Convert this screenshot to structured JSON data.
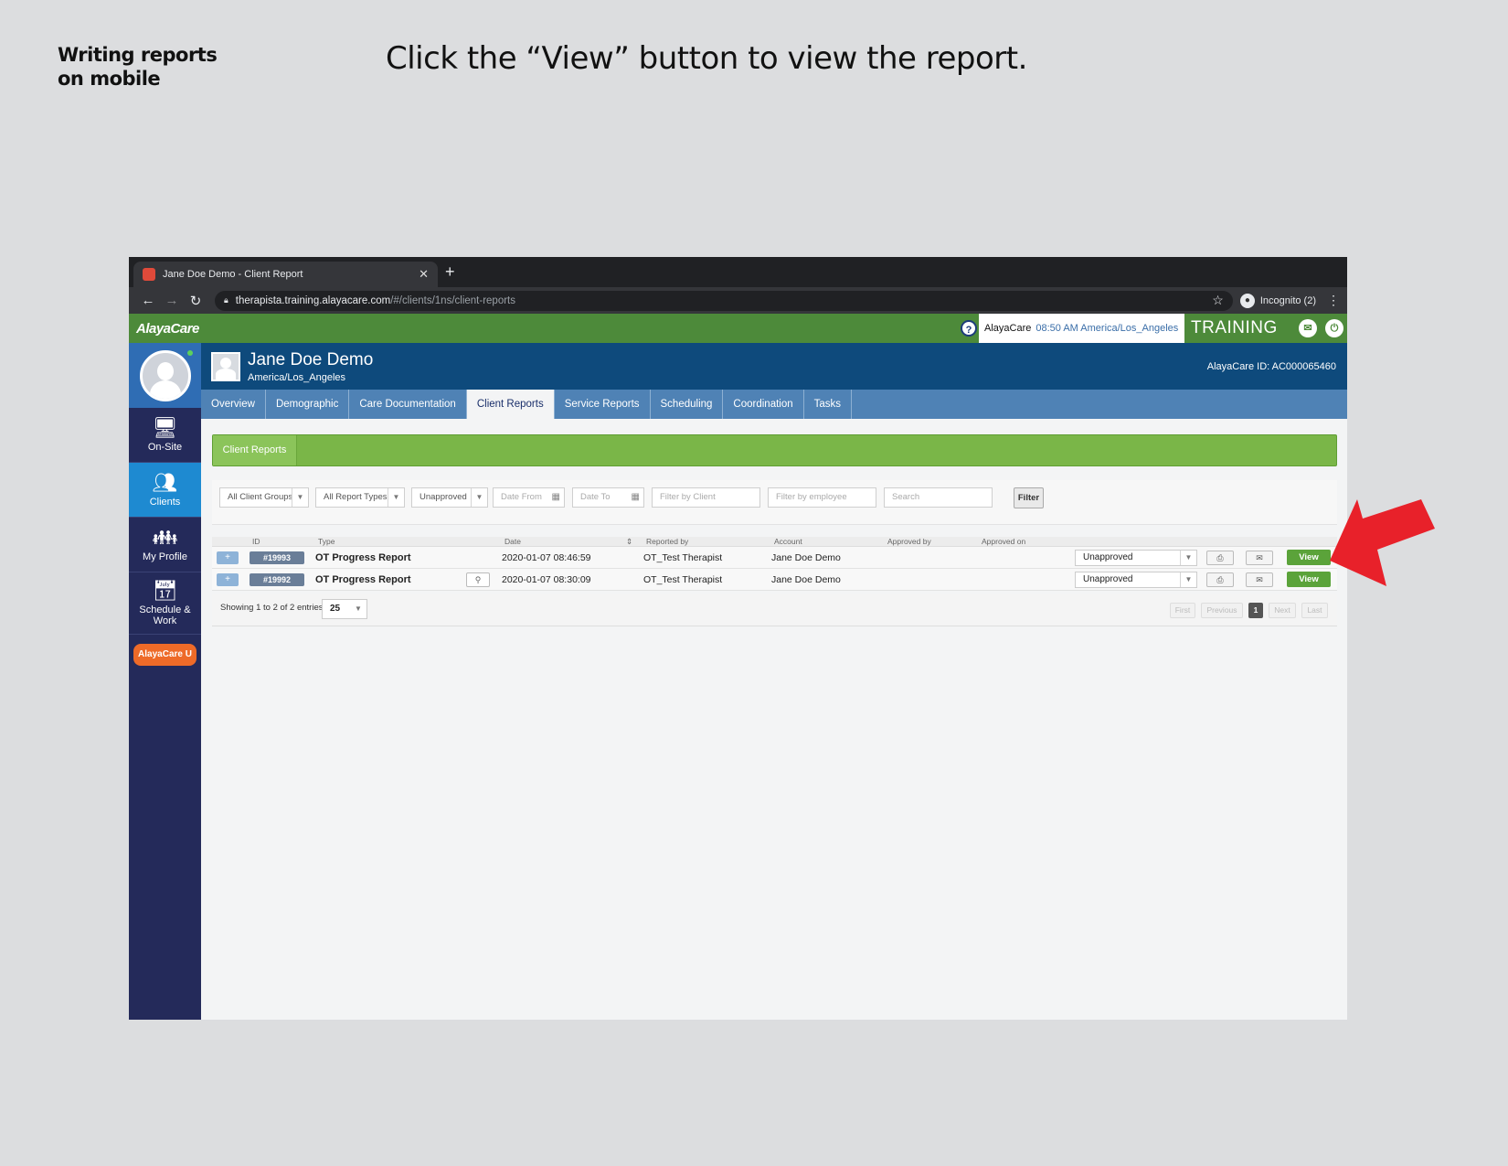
{
  "slide": {
    "section_line1": "Writing reports",
    "section_line2": "on mobile",
    "instruction": "Click the “View” button to view the report."
  },
  "browser": {
    "tab_title": "Jane Doe Demo - Client Report",
    "url_host": "therapista.training.alayacare.com",
    "url_path": "/#/clients/1ns/client-reports",
    "incognito_label": "Incognito (2)"
  },
  "app": {
    "logo": "AlayaCare",
    "clock_brand": "AlayaCare",
    "clock_time": "08:50 AM America/Los_Angeles",
    "env_label": "TRAINING",
    "help_icon_text": "?"
  },
  "sidebar": {
    "items": [
      {
        "label": "On-Site",
        "icon": "monitor-icon"
      },
      {
        "label": "Clients",
        "icon": "people-icon"
      },
      {
        "label": "My Profile",
        "icon": "group-icon"
      },
      {
        "label": "Schedule & Work",
        "icon": "calendar-icon"
      }
    ],
    "alaya_u": "AlayaCare U"
  },
  "client": {
    "name": "Jane Doe Demo",
    "timezone": "America/Los_Angeles",
    "id_label": "AlayaCare ID: AC000065460"
  },
  "nav_tabs": [
    {
      "label": "Overview"
    },
    {
      "label": "Demographic"
    },
    {
      "label": "Care Documentation"
    },
    {
      "label": "Client Reports"
    },
    {
      "label": "Service Reports"
    },
    {
      "label": "Scheduling"
    },
    {
      "label": "Coordination"
    },
    {
      "label": "Tasks"
    }
  ],
  "section": {
    "tab_label": "Client Reports"
  },
  "filters": {
    "client_groups": "All Client Groups",
    "report_types": "All Report Types",
    "status": "Unapproved",
    "date_from": "Date From",
    "date_to": "Date To",
    "filter_client": "Filter by Client",
    "filter_employee": "Filter by employee",
    "search": "Search",
    "filter_button": "Filter"
  },
  "table": {
    "headers": {
      "id": "ID",
      "type": "Type",
      "date": "Date",
      "reported_by": "Reported by",
      "account": "Account",
      "approved_by": "Approved by",
      "approved_on": "Approved on"
    },
    "rows": [
      {
        "id": "#19993",
        "type": "OT Progress Report",
        "date": "2020-01-07 08:46:59",
        "reported_by": "OT_Test Therapist",
        "account": "Jane Doe Demo",
        "status": "Unapproved",
        "view": "View"
      },
      {
        "id": "#19992",
        "type": "OT Progress Report",
        "date": "2020-01-07 08:30:09",
        "reported_by": "OT_Test Therapist",
        "account": "Jane Doe Demo",
        "status": "Unapproved",
        "view": "View"
      }
    ],
    "expand_symbol": "+",
    "showing_text": "Showing 1 to 2 of 2 entries",
    "page_size": "25",
    "pager": {
      "first": "First",
      "previous": "Previous",
      "current": "1",
      "next": "Next",
      "last": "Last"
    }
  },
  "colors": {
    "app_green": "#4d8a3a",
    "header_blue": "#0e4a7c",
    "sidebar_navy": "#242a5a",
    "view_green": "#5ba33a",
    "arrow_red": "#e8212a"
  }
}
